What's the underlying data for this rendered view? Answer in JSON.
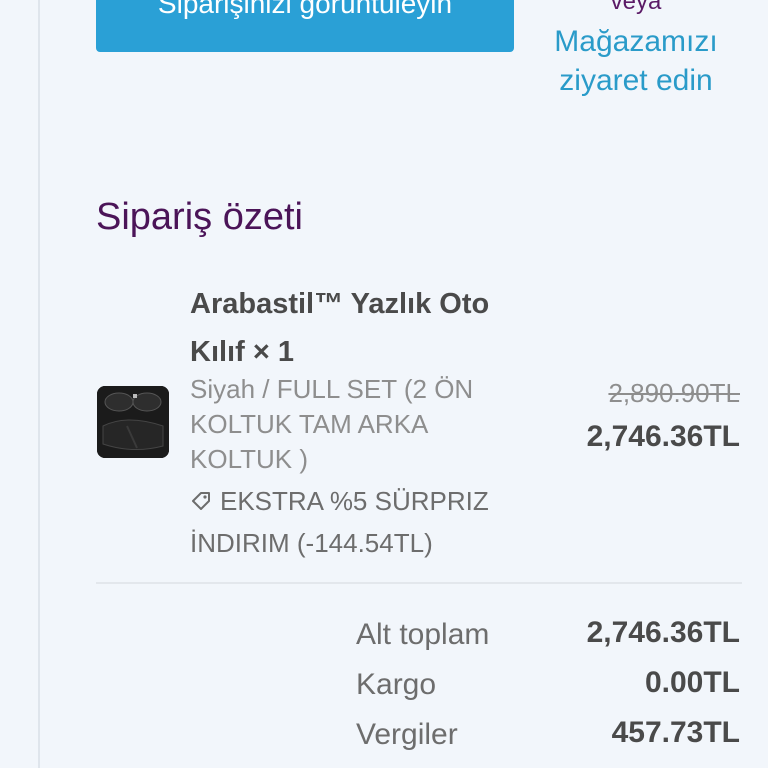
{
  "actions": {
    "view_order_label": "Siparişinizi görüntüleyin",
    "or_label": "veya",
    "visit_store_label": "Mağazamızı ziyaret edin"
  },
  "summary": {
    "title": "Sipariş özeti",
    "items": [
      {
        "name": "Arabastil™ Yazlık Oto Kılıf × 1",
        "variant": "Siyah / FULL SET (2 ÖN KOLTUK TAM ARKA KOLTUK )",
        "discount_text": "EKSTRA %5 SÜRPRIZ İNDIRIM (-144.54TL)",
        "price_original": "2,890.90TL",
        "price_final": "2,746.36TL"
      }
    ],
    "totals": [
      {
        "label": "Alt toplam",
        "value": "2,746.36TL"
      },
      {
        "label": "Kargo",
        "value": "0.00TL"
      },
      {
        "label": "Vergiler",
        "value": "457.73TL"
      }
    ]
  },
  "colors": {
    "accent_button": "#2aa0d6",
    "link": "#2a9bc9",
    "title_purple": "#4b1458"
  },
  "icons": {
    "discount": "tag-icon"
  }
}
